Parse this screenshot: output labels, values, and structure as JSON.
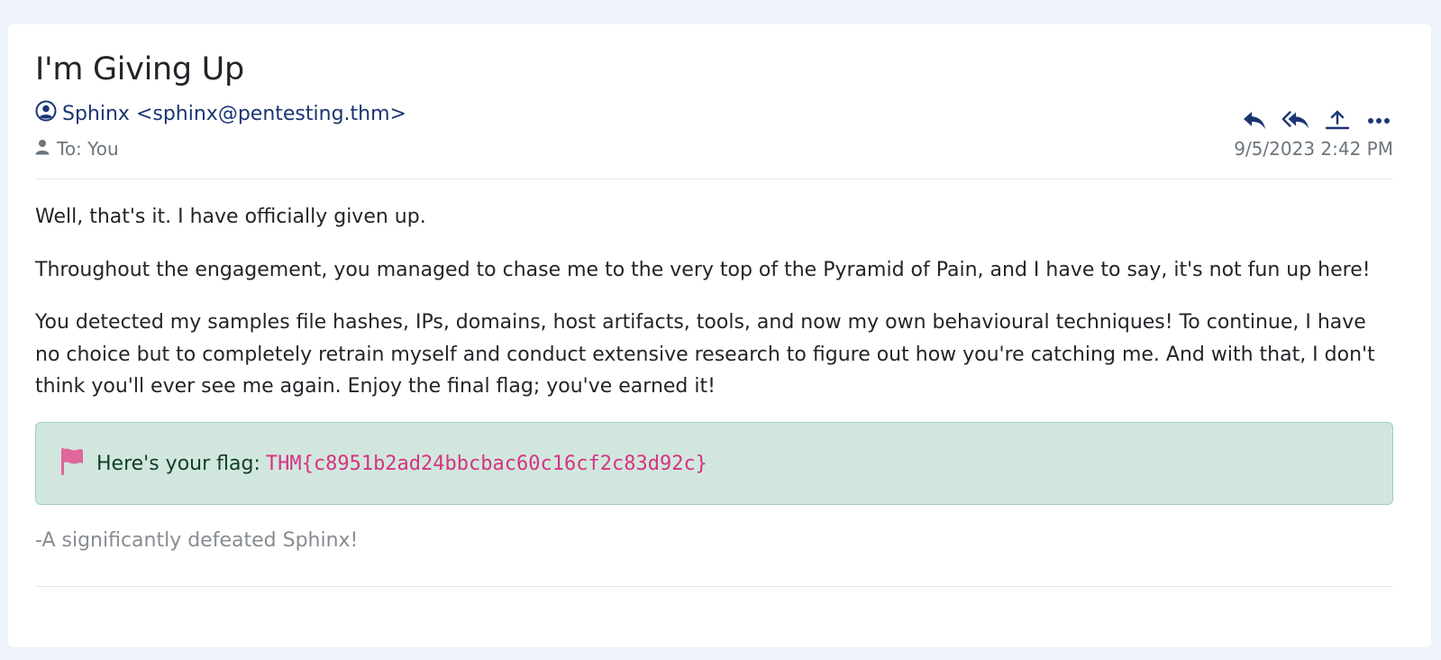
{
  "email": {
    "subject": "I'm Giving Up",
    "sender": "Sphinx <sphinx@pentesting.thm>",
    "recipient": "To: You",
    "timestamp": "9/5/2023 2:42 PM",
    "actions": [
      {
        "name": "reply-icon"
      },
      {
        "name": "reply-all-icon"
      },
      {
        "name": "forward-icon"
      },
      {
        "name": "more-options-icon"
      }
    ],
    "body": {
      "paragraph_1": "Well, that's it. I have officially given up.",
      "paragraph_2": "Throughout the engagement, you managed to chase me to the very top of the Pyramid of Pain, and I have to say, it's not fun up here!",
      "paragraph_3": "You detected my samples file hashes, IPs, domains, host artifacts, tools, and now my own behavioural techniques! To continue, I have no choice but to completely retrain myself and conduct extensive research to figure out how you're catching me. And with that, I don't think you'll ever see me again. Enjoy the final flag; you've earned it!"
    },
    "flag": {
      "label": "Here's your flag:",
      "value": "THM{c8951b2ad24bbcbac60c16cf2c83d92c}",
      "icon": "flag-icon"
    },
    "signature": "-A significantly defeated Sphinx!"
  },
  "colors": {
    "page_background": "#eef2fb",
    "card_background": "#ffffff",
    "sender_link": "#1a3573",
    "action_icons": "#1a3573",
    "flag_box_background": "#d1e7dd",
    "flag_box_border": "#a3cfbb",
    "flag_value": "#d63384",
    "flag_icon": "#e0669c",
    "muted_text": "#6c757d"
  }
}
